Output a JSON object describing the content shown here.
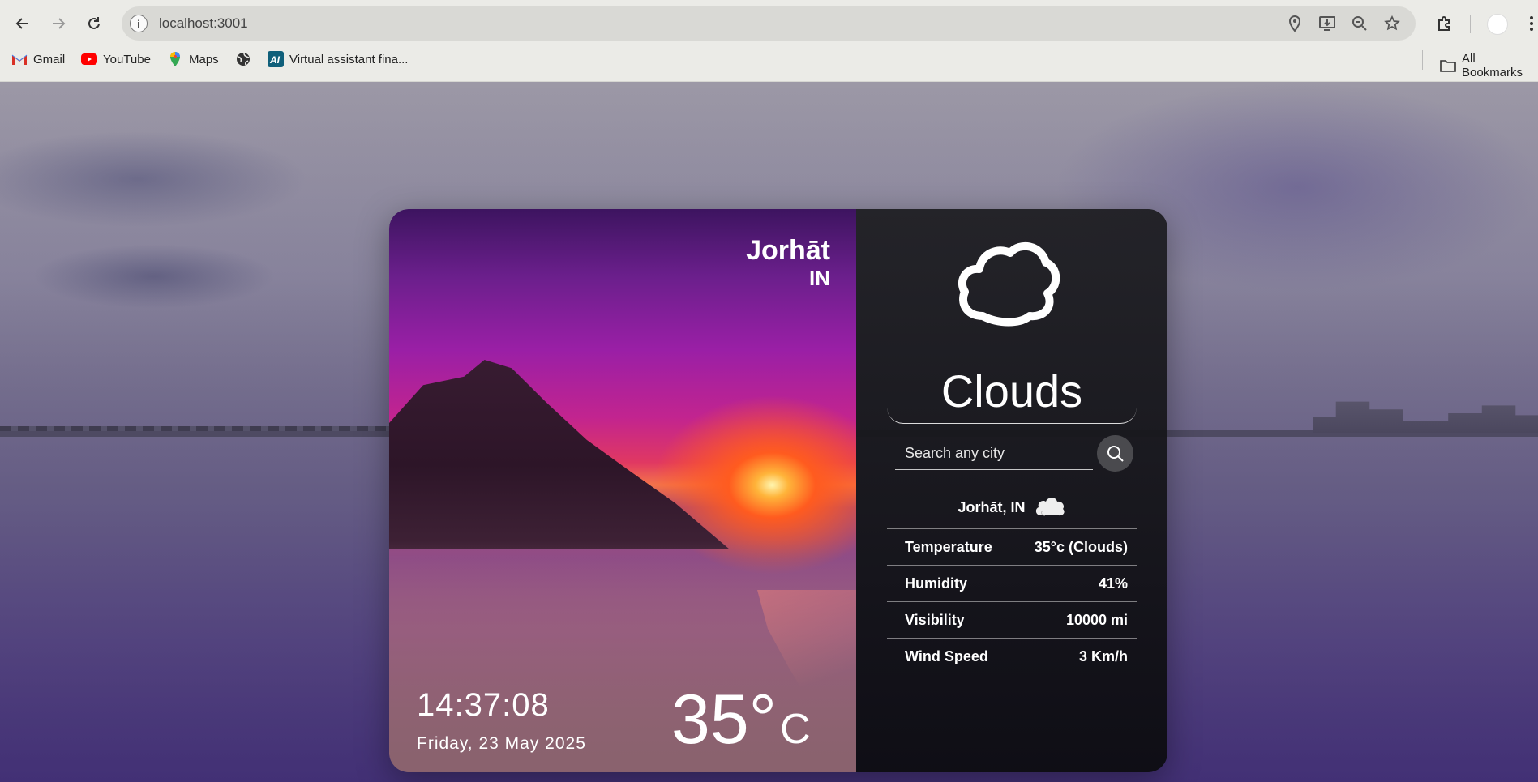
{
  "browser": {
    "url": "localhost:3001",
    "bookmarks": [
      {
        "label": "Gmail",
        "icon": "gmail-icon"
      },
      {
        "label": "YouTube",
        "icon": "youtube-icon"
      },
      {
        "label": "Maps",
        "icon": "maps-icon"
      },
      {
        "label": "",
        "icon": "globe-icon"
      },
      {
        "label": "Virtual assistant fina...",
        "icon": "ai-icon"
      }
    ],
    "all_bookmarks": "All Bookmarks"
  },
  "left_panel": {
    "city": "Jorhāt",
    "country": "IN",
    "time": "14:37:08",
    "date": "Friday, 23 May 2025",
    "temperature": "35°",
    "unit": "C"
  },
  "right_panel": {
    "condition": "Clouds",
    "condition_icon": "cloud-icon",
    "search_placeholder": "Search any city",
    "location": "Jorhāt, IN",
    "stats": [
      {
        "label": "Temperature",
        "value": "35°c (Clouds)"
      },
      {
        "label": "Humidity",
        "value": "41%"
      },
      {
        "label": "Visibility",
        "value": "10000 mi"
      },
      {
        "label": "Wind Speed",
        "value": "3 Km/h"
      }
    ]
  }
}
